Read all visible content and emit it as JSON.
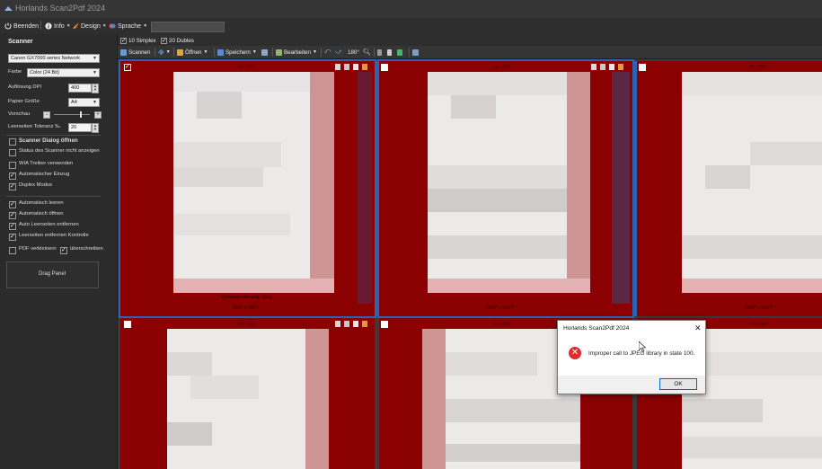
{
  "title": "Horlands Scan2Pdf 2024",
  "menu": {
    "beenden": "Beenden",
    "info": "Info",
    "design": "Design",
    "sprache": "Sprache"
  },
  "scanner": {
    "heading": "Scanner",
    "device": "Canon GX7000 series Network",
    "farbe_label": "Farbe",
    "farbe_value": "Color (24 Bit)",
    "dpi_label": "Auflösung DPI",
    "dpi_value": "400",
    "papier_label": "Papier Größe",
    "papier_value": "A4",
    "vorschau_label": "Vorschau",
    "vorschau_level": 0.74,
    "toleranz_label": "Leerseiten Toleranz ‰",
    "toleranz_value": "20"
  },
  "options": [
    {
      "label": "Scanner Dialog öffnen",
      "checked": false,
      "bold": true
    },
    {
      "label": "Status des Scanner nicht anzeigen",
      "checked": false
    },
    {
      "label": "WIA Treiber verwenden",
      "checked": false
    },
    {
      "label": "Automatischer Einzug",
      "checked": true
    },
    {
      "label": "Duplex Modus",
      "checked": true
    },
    {
      "label": "Automatisch leeren",
      "checked": true
    },
    {
      "label": "Automatisch öffnen",
      "checked": true
    },
    {
      "label": "Auto Leerseiten entfernen",
      "checked": true
    },
    {
      "label": "Leerseiten entfernen Kontrolle",
      "checked": true
    }
  ],
  "pdf_verkleinern": "PDF verkleinern",
  "ueberschreiben": "überschreiben",
  "drag_panel": "Drag Panel",
  "toolbar": {
    "simplex": "10 Simplex",
    "dubles": "20 Dubles",
    "scannen": "Scannen",
    "oeffnen": "Öffnen",
    "speichern": "Speichern",
    "bearbeiten": "Bearbeiten",
    "rotate": "180°"
  },
  "pages": [
    {
      "header": "Nr. 001",
      "footer": "2907 x 4677",
      "label": "Kennzeichnung: Doc"
    },
    {
      "header": "Nr. 002",
      "footer": "2907 x 4677"
    },
    {
      "header": "Nr. 003",
      "footer": "2907 x 4677"
    },
    {
      "header": "Nr. 003"
    },
    {
      "header": "Nr. 004"
    },
    {
      "header": "Nr. 004"
    }
  ],
  "dialog": {
    "title": "Horlands Scan2Pdf 2024",
    "message": "Improper call to JPEG library in state 100.",
    "ok": "OK"
  },
  "colors": {
    "page_red": "#8b0000",
    "selection_blue": "#2a64b4",
    "error_red": "#e02c2c"
  }
}
